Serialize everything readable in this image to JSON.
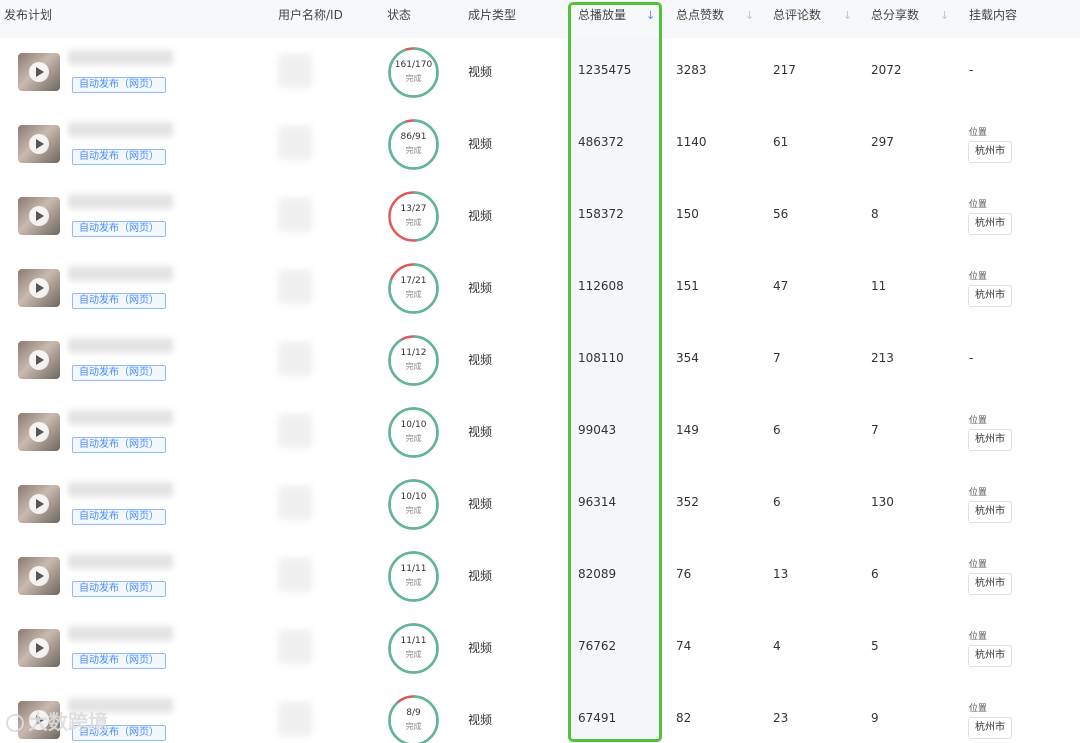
{
  "columns": {
    "plan": "发布计划",
    "user": "用户名称/ID",
    "status": "状态",
    "type": "成片类型",
    "plays": "总播放量",
    "likes": "总点赞数",
    "comments": "总评论数",
    "shares": "总分享数",
    "mount": "挂载内容"
  },
  "status_sub": "完成",
  "tag_label": "自动发布（网页）",
  "colors": {
    "accent": "#4a8cff",
    "highlight": "#52c23a",
    "ring_done": "#5bb89a",
    "ring_fail": "#e05858"
  },
  "rows": [
    {
      "status": "161/170",
      "progress": 0.947,
      "type": "视频",
      "plays": "1235475",
      "likes": "3283",
      "comments": "217",
      "shares": "2072",
      "mount_text": "-",
      "loc_label": "",
      "loc": ""
    },
    {
      "status": "86/91",
      "progress": 0.945,
      "type": "视频",
      "plays": "486372",
      "likes": "1140",
      "comments": "61",
      "shares": "297",
      "mount_text": "",
      "loc_label": "位置",
      "loc": "杭州市"
    },
    {
      "status": "13/27",
      "progress": 0.481,
      "type": "视频",
      "plays": "158372",
      "likes": "150",
      "comments": "56",
      "shares": "8",
      "mount_text": "",
      "loc_label": "位置",
      "loc": "杭州市"
    },
    {
      "status": "17/21",
      "progress": 0.81,
      "type": "视频",
      "plays": "112608",
      "likes": "151",
      "comments": "47",
      "shares": "11",
      "mount_text": "",
      "loc_label": "位置",
      "loc": "杭州市"
    },
    {
      "status": "11/12",
      "progress": 0.917,
      "type": "视频",
      "plays": "108110",
      "likes": "354",
      "comments": "7",
      "shares": "213",
      "mount_text": "-",
      "loc_label": "",
      "loc": ""
    },
    {
      "status": "10/10",
      "progress": 1,
      "type": "视频",
      "plays": "99043",
      "likes": "149",
      "comments": "6",
      "shares": "7",
      "mount_text": "",
      "loc_label": "位置",
      "loc": "杭州市"
    },
    {
      "status": "10/10",
      "progress": 1,
      "type": "视频",
      "plays": "96314",
      "likes": "352",
      "comments": "6",
      "shares": "130",
      "mount_text": "",
      "loc_label": "位置",
      "loc": "杭州市"
    },
    {
      "status": "11/11",
      "progress": 1,
      "type": "视频",
      "plays": "82089",
      "likes": "76",
      "comments": "13",
      "shares": "6",
      "mount_text": "",
      "loc_label": "位置",
      "loc": "杭州市"
    },
    {
      "status": "11/11",
      "progress": 1,
      "type": "视频",
      "plays": "76762",
      "likes": "74",
      "comments": "4",
      "shares": "5",
      "mount_text": "",
      "loc_label": "位置",
      "loc": "杭州市"
    },
    {
      "status": "8/9",
      "progress": 0.889,
      "type": "视频",
      "plays": "67491",
      "likes": "82",
      "comments": "23",
      "shares": "9",
      "mount_text": "",
      "loc_label": "位置",
      "loc": "杭州市"
    }
  ],
  "watermark": "大数跨境"
}
